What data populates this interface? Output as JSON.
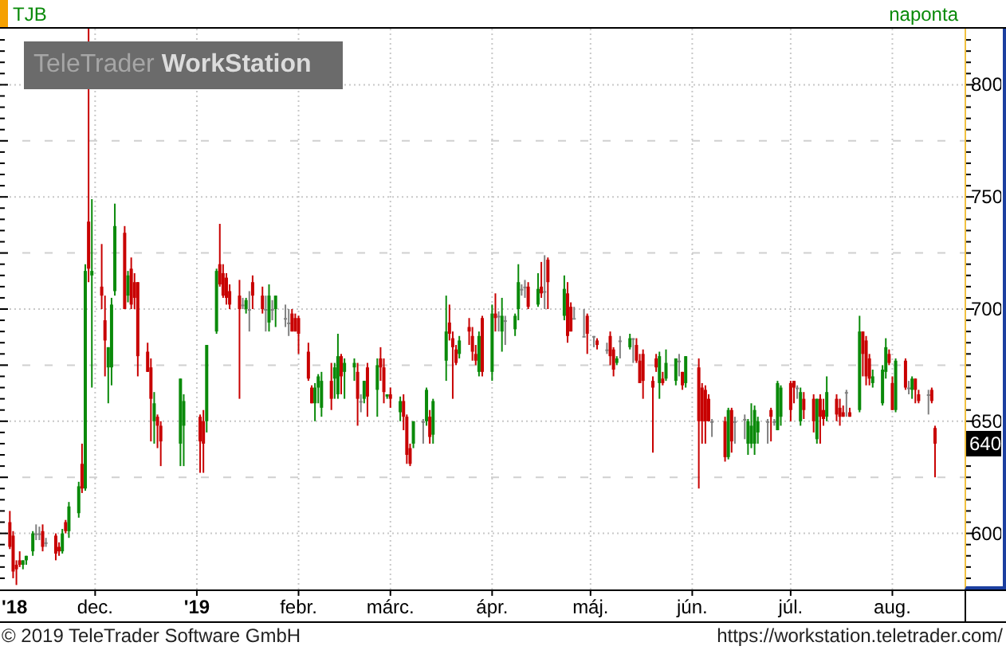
{
  "header": {
    "symbol": "TJB",
    "interval": "naponta"
  },
  "watermark": "TeleTrader **WorkStation**",
  "chart": {
    "chart_data": {
      "type": "candlestick",
      "grid": true,
      "xlim": [
        "2018-11-02",
        "2019-08-23"
      ],
      "ylim": [
        575,
        825
      ],
      "yticks": [
        {
          "value": 600,
          "label": "600"
        },
        {
          "value": 650,
          "label": "650"
        },
        {
          "value": 700,
          "label": "700"
        },
        {
          "value": 750,
          "label": "750"
        },
        {
          "value": 800,
          "label": "800"
        }
      ],
      "x": [
        "2018-11-05",
        "2018-11-06",
        "2018-11-07",
        "2018-11-08",
        "2018-11-09",
        "2018-11-10",
        "2018-11-12",
        "2018-11-13",
        "2018-11-14",
        "2018-11-15",
        "2018-11-16",
        "2018-11-19",
        "2018-11-20",
        "2018-11-21",
        "2018-11-22",
        "2018-11-23",
        "2018-11-26",
        "2018-11-27",
        "2018-11-28",
        "2018-11-29",
        "2018-11-30",
        "2018-12-03",
        "2018-12-04",
        "2018-12-05",
        "2018-12-06",
        "2018-12-07",
        "2018-12-10",
        "2018-12-11",
        "2018-12-12",
        "2018-12-13",
        "2018-12-14",
        "2018-12-17",
        "2018-12-18",
        "2018-12-19",
        "2018-12-20",
        "2018-12-21",
        "2018-12-27",
        "2018-12-28",
        "2019-01-02",
        "2019-01-03",
        "2019-01-04",
        "2019-01-07",
        "2019-01-08",
        "2019-01-09",
        "2019-01-10",
        "2019-01-11",
        "2019-01-14",
        "2019-01-15",
        "2019-01-16",
        "2019-01-17",
        "2019-01-18",
        "2019-01-21",
        "2019-01-22",
        "2019-01-23",
        "2019-01-24",
        "2019-01-25",
        "2019-01-28",
        "2019-01-29",
        "2019-01-30",
        "2019-01-31",
        "2019-02-01",
        "2019-02-04",
        "2019-02-05",
        "2019-02-06",
        "2019-02-07",
        "2019-02-08",
        "2019-02-11",
        "2019-02-12",
        "2019-02-13",
        "2019-02-14",
        "2019-02-15",
        "2019-02-18",
        "2019-02-19",
        "2019-02-20",
        "2019-02-21",
        "2019-02-22",
        "2019-02-25",
        "2019-02-26",
        "2019-02-27",
        "2019-02-28",
        "2019-03-01",
        "2019-03-04",
        "2019-03-05",
        "2019-03-06",
        "2019-03-07",
        "2019-03-08",
        "2019-03-11",
        "2019-03-12",
        "2019-03-13",
        "2019-03-14",
        "2019-03-18",
        "2019-03-19",
        "2019-03-20",
        "2019-03-21",
        "2019-03-22",
        "2019-03-25",
        "2019-03-26",
        "2019-03-27",
        "2019-03-28",
        "2019-03-29",
        "2019-04-01",
        "2019-04-02",
        "2019-04-03",
        "2019-04-04",
        "2019-04-05",
        "2019-04-08",
        "2019-04-09",
        "2019-04-10",
        "2019-04-11",
        "2019-04-12",
        "2019-04-15",
        "2019-04-16",
        "2019-04-17",
        "2019-04-18",
        "2019-04-23",
        "2019-04-24",
        "2019-04-25",
        "2019-04-26",
        "2019-04-29",
        "2019-04-30",
        "2019-05-02",
        "2019-05-03",
        "2019-05-06",
        "2019-05-07",
        "2019-05-08",
        "2019-05-09",
        "2019-05-10",
        "2019-05-13",
        "2019-05-14",
        "2019-05-15",
        "2019-05-16",
        "2019-05-17",
        "2019-05-20",
        "2019-05-21",
        "2019-05-22",
        "2019-05-23",
        "2019-05-24",
        "2019-05-27",
        "2019-05-28",
        "2019-05-29",
        "2019-05-30",
        "2019-06-03",
        "2019-06-04",
        "2019-06-05",
        "2019-06-06",
        "2019-06-07",
        "2019-06-11",
        "2019-06-12",
        "2019-06-13",
        "2019-06-14",
        "2019-06-17",
        "2019-06-18",
        "2019-06-19",
        "2019-06-20",
        "2019-06-21",
        "2019-06-24",
        "2019-06-25",
        "2019-06-26",
        "2019-06-27",
        "2019-06-28",
        "2019-07-01",
        "2019-07-02",
        "2019-07-03",
        "2019-07-04",
        "2019-07-05",
        "2019-07-08",
        "2019-07-09",
        "2019-07-10",
        "2019-07-11",
        "2019-07-12",
        "2019-07-15",
        "2019-07-16",
        "2019-07-17",
        "2019-07-18",
        "2019-07-19",
        "2019-07-22",
        "2019-07-23",
        "2019-07-24",
        "2019-07-25",
        "2019-07-26",
        "2019-07-29",
        "2019-07-30",
        "2019-07-31",
        "2019-08-01",
        "2019-08-02",
        "2019-08-05",
        "2019-08-06",
        "2019-08-07",
        "2019-08-08",
        "2019-08-09",
        "2019-08-12",
        "2019-08-13",
        "2019-08-14"
      ],
      "xticks": [
        {
          "value": "2018-11-02",
          "label": "'18"
        },
        {
          "value": "2018-12-01",
          "label": "dec."
        },
        {
          "value": "2019-01-01",
          "label": "'19"
        },
        {
          "value": "2019-02-01",
          "label": "febr."
        },
        {
          "value": "2019-03-01",
          "label": "márc."
        },
        {
          "value": "2019-04-01",
          "label": "ápr."
        },
        {
          "value": "2019-05-01",
          "label": "máj."
        },
        {
          "value": "2019-06-01",
          "label": "jún."
        },
        {
          "value": "2019-07-01",
          "label": "júl."
        },
        {
          "value": "2019-08-01",
          "label": "aug."
        }
      ],
      "annotations": [
        "640"
      ],
      "ohlc": [
        [
          605,
          610,
          593,
          594
        ],
        [
          599,
          601,
          580,
          583
        ],
        [
          586,
          588,
          577,
          584
        ],
        [
          588,
          592,
          585,
          586
        ],
        [
          586,
          588,
          584,
          588
        ],
        [
          588,
          590,
          586,
          590
        ],
        [
          592,
          601,
          590,
          600
        ],
        [
          600,
          604,
          597,
          600
        ],
        [
          600,
          603,
          597,
          600
        ],
        [
          601,
          604,
          592,
          594
        ],
        [
          596,
          598,
          594,
          596
        ],
        [
          599,
          600,
          588,
          591
        ],
        [
          594,
          596,
          590,
          592
        ],
        [
          592,
          602,
          591,
          600
        ],
        [
          605,
          606,
          600,
          601
        ],
        [
          601,
          614,
          598,
          612
        ],
        [
          609,
          623,
          607,
          621
        ],
        [
          631,
          640,
          618,
          620
        ],
        [
          620,
          720,
          619,
          717
        ],
        [
          739,
          825,
          712,
          718
        ],
        [
          715,
          749,
          665,
          717
        ],
        [
          710,
          729,
          700,
          706
        ],
        [
          695,
          706,
          670,
          686
        ],
        [
          674,
          683,
          658,
          683
        ],
        [
          674,
          705,
          666,
          702
        ],
        [
          708,
          747,
          706,
          737
        ],
        [
          734,
          737,
          700,
          700
        ],
        [
          706,
          717,
          703,
          715
        ],
        [
          718,
          723,
          700,
          702
        ],
        [
          712,
          716,
          700,
          705
        ],
        [
          712,
          712,
          670,
          679
        ],
        [
          681,
          685,
          672,
          672
        ],
        [
          674,
          678,
          641,
          660
        ],
        [
          650,
          663,
          640,
          658
        ],
        [
          652,
          653,
          638,
          648
        ],
        [
          648,
          650,
          630,
          641
        ],
        [
          640,
          669,
          630,
          669
        ],
        [
          648,
          662,
          630,
          659
        ],
        [
          652,
          653,
          627,
          641
        ],
        [
          650,
          655,
          627,
          640
        ],
        [
          650,
          684,
          645,
          684
        ],
        [
          690,
          718,
          689,
          717
        ],
        [
          720,
          738,
          710,
          711
        ],
        [
          716,
          720,
          705,
          706
        ],
        [
          714,
          716,
          702,
          705
        ],
        [
          708,
          711,
          700,
          702
        ],
        [
          706,
          713,
          660,
          700
        ],
        [
          702,
          705,
          700,
          702
        ],
        [
          700,
          705,
          698,
          704
        ],
        [
          700,
          708,
          690,
          700
        ],
        [
          712,
          715,
          700,
          706
        ],
        [
          706,
          710,
          698,
          700
        ],
        [
          700,
          706,
          690,
          700
        ],
        [
          694,
          711,
          690,
          706
        ],
        [
          700,
          704,
          695,
          700
        ],
        [
          700,
          706,
          692,
          706
        ],
        [
          696,
          702,
          692,
          696
        ],
        [
          694,
          700,
          688,
          694
        ],
        [
          698,
          700,
          690,
          690
        ],
        [
          696,
          698,
          690,
          690
        ],
        [
          696,
          697,
          680,
          689
        ],
        [
          681,
          685,
          668,
          669
        ],
        [
          665,
          666,
          658,
          658
        ],
        [
          658,
          667,
          650,
          665
        ],
        [
          665,
          671,
          658,
          670
        ],
        [
          656,
          672,
          652,
          668
        ],
        [
          668,
          676,
          655,
          660
        ],
        [
          669,
          676,
          660,
          674
        ],
        [
          662,
          689,
          660,
          679
        ],
        [
          679,
          680,
          662,
          670
        ],
        [
          672,
          678,
          660,
          676
        ],
        [
          674,
          678,
          668,
          676
        ],
        [
          672,
          676,
          648,
          660
        ],
        [
          659,
          662,
          654,
          659
        ],
        [
          660,
          668,
          658,
          668
        ],
        [
          674,
          676,
          652,
          661
        ],
        [
          664,
          678,
          652,
          675
        ],
        [
          678,
          683,
          668,
          674
        ],
        [
          674,
          678,
          658,
          663
        ],
        [
          661,
          662,
          660,
          662
        ],
        [
          662,
          665,
          656,
          660
        ],
        [
          654,
          661,
          650,
          659
        ],
        [
          659,
          662,
          646,
          652
        ],
        [
          652,
          653,
          631,
          635
        ],
        [
          638,
          640,
          630,
          631
        ],
        [
          640,
          650,
          638,
          650
        ],
        [
          650,
          651,
          640,
          650
        ],
        [
          650,
          665,
          648,
          664
        ],
        [
          652,
          655,
          640,
          643
        ],
        [
          644,
          660,
          640,
          659
        ],
        [
          677,
          706,
          668,
          690
        ],
        [
          694,
          702,
          686,
          689
        ],
        [
          687,
          690,
          660,
          683
        ],
        [
          682,
          684,
          675,
          676
        ],
        [
          680,
          688,
          678,
          686
        ],
        [
          692,
          696,
          684,
          690
        ],
        [
          688,
          692,
          677,
          681
        ],
        [
          680,
          684,
          675,
          677
        ],
        [
          672,
          690,
          670,
          688
        ],
        [
          696,
          697,
          670,
          672
        ],
        [
          672,
          702,
          668,
          698
        ],
        [
          698,
          707,
          690,
          696
        ],
        [
          697,
          699,
          690,
          697
        ],
        [
          690,
          705,
          681,
          697
        ],
        [
          695,
          697,
          684,
          695
        ],
        [
          691,
          698,
          688,
          697
        ],
        [
          700,
          720,
          695,
          712
        ],
        [
          709,
          711,
          706,
          709
        ],
        [
          710,
          713,
          705,
          710
        ],
        [
          710,
          712,
          700,
          701
        ],
        [
          702,
          716,
          701,
          709
        ],
        [
          710,
          721,
          705,
          707
        ],
        [
          708,
          724,
          700,
          708
        ],
        [
          722,
          723,
          700,
          712
        ],
        [
          697,
          715,
          695,
          709
        ],
        [
          707,
          712,
          685,
          688
        ],
        [
          701,
          703,
          690,
          690
        ],
        [
          696,
          701,
          696,
          696
        ],
        [
          688,
          700,
          688,
          688
        ],
        [
          697,
          698,
          680,
          689
        ],
        [
          688,
          688,
          683,
          688
        ],
        [
          686,
          687,
          682,
          684
        ],
        [
          682,
          685,
          680,
          682
        ],
        [
          688,
          690,
          675,
          679
        ],
        [
          682,
          683,
          670,
          673
        ],
        [
          676,
          679,
          675,
          678
        ],
        [
          686,
          688,
          678,
          686
        ],
        [
          683,
          689,
          682,
          687
        ],
        [
          687,
          687,
          676,
          687
        ],
        [
          684,
          687,
          676,
          677
        ],
        [
          677,
          680,
          667,
          667
        ],
        [
          680,
          682,
          660,
          668
        ],
        [
          668,
          670,
          636,
          665
        ],
        [
          678,
          680,
          672,
          674
        ],
        [
          667,
          681,
          660,
          679
        ],
        [
          669,
          672,
          666,
          667
        ],
        [
          669,
          682,
          668,
          676
        ],
        [
          668,
          678,
          666,
          678
        ],
        [
          677,
          680,
          670,
          677
        ],
        [
          672,
          672,
          664,
          666
        ],
        [
          667,
          679,
          665,
          679
        ],
        [
          674,
          678,
          620,
          650
        ],
        [
          665,
          667,
          640,
          650
        ],
        [
          664,
          666,
          640,
          650
        ],
        [
          660,
          662,
          650,
          650
        ],
        [
          650,
          651,
          643,
          650
        ],
        [
          650,
          652,
          632,
          634
        ],
        [
          634,
          656,
          633,
          655
        ],
        [
          655,
          656,
          636,
          641
        ],
        [
          650,
          652,
          640,
          650
        ],
        [
          651,
          653,
          642,
          651
        ],
        [
          640,
          651,
          635,
          650
        ],
        [
          640,
          658,
          638,
          648
        ],
        [
          640,
          657,
          635,
          655
        ],
        [
          645,
          652,
          640,
          650
        ],
        [
          650,
          651,
          640,
          650
        ],
        [
          655,
          656,
          641,
          652
        ],
        [
          650,
          651,
          648,
          650
        ],
        [
          646,
          668,
          646,
          667
        ],
        [
          652,
          666,
          648,
          665
        ],
        [
          667,
          668,
          650,
          655
        ],
        [
          668,
          668,
          658,
          665
        ],
        [
          665,
          666,
          660,
          665
        ],
        [
          650,
          665,
          648,
          663
        ],
        [
          660,
          663,
          651,
          655
        ],
        [
          660,
          662,
          645,
          650
        ],
        [
          642,
          660,
          640,
          660
        ],
        [
          660,
          662,
          640,
          652
        ],
        [
          655,
          660,
          648,
          651
        ],
        [
          652,
          670,
          650,
          663
        ],
        [
          660,
          662,
          650,
          653
        ],
        [
          656,
          660,
          648,
          652
        ],
        [
          654,
          657,
          652,
          652
        ],
        [
          663,
          664,
          652,
          663
        ],
        [
          654,
          656,
          652,
          652
        ],
        [
          655,
          697,
          654,
          690
        ],
        [
          690,
          690,
          670,
          680
        ],
        [
          686,
          688,
          666,
          670
        ],
        [
          678,
          680,
          666,
          669
        ],
        [
          667,
          673,
          665,
          670
        ],
        [
          658,
          675,
          657,
          673
        ],
        [
          672,
          687,
          669,
          683
        ],
        [
          680,
          682,
          675,
          676
        ],
        [
          667,
          670,
          655,
          655
        ],
        [
          655,
          678,
          654,
          677
        ],
        [
          677,
          678,
          664,
          665
        ],
        [
          665,
          668,
          662,
          665
        ],
        [
          664,
          670,
          660,
          669
        ],
        [
          669,
          669,
          658,
          664
        ],
        [
          662,
          664,
          658,
          659
        ],
        [
          662,
          664,
          653,
          662
        ],
        [
          664,
          665,
          658,
          659
        ],
        [
          647,
          648,
          625,
          640
        ]
      ]
    }
  },
  "footer": {
    "copyright": "© 2019 TeleTrader Software GmbH",
    "url": "https://workstation.teletrader.com/"
  }
}
